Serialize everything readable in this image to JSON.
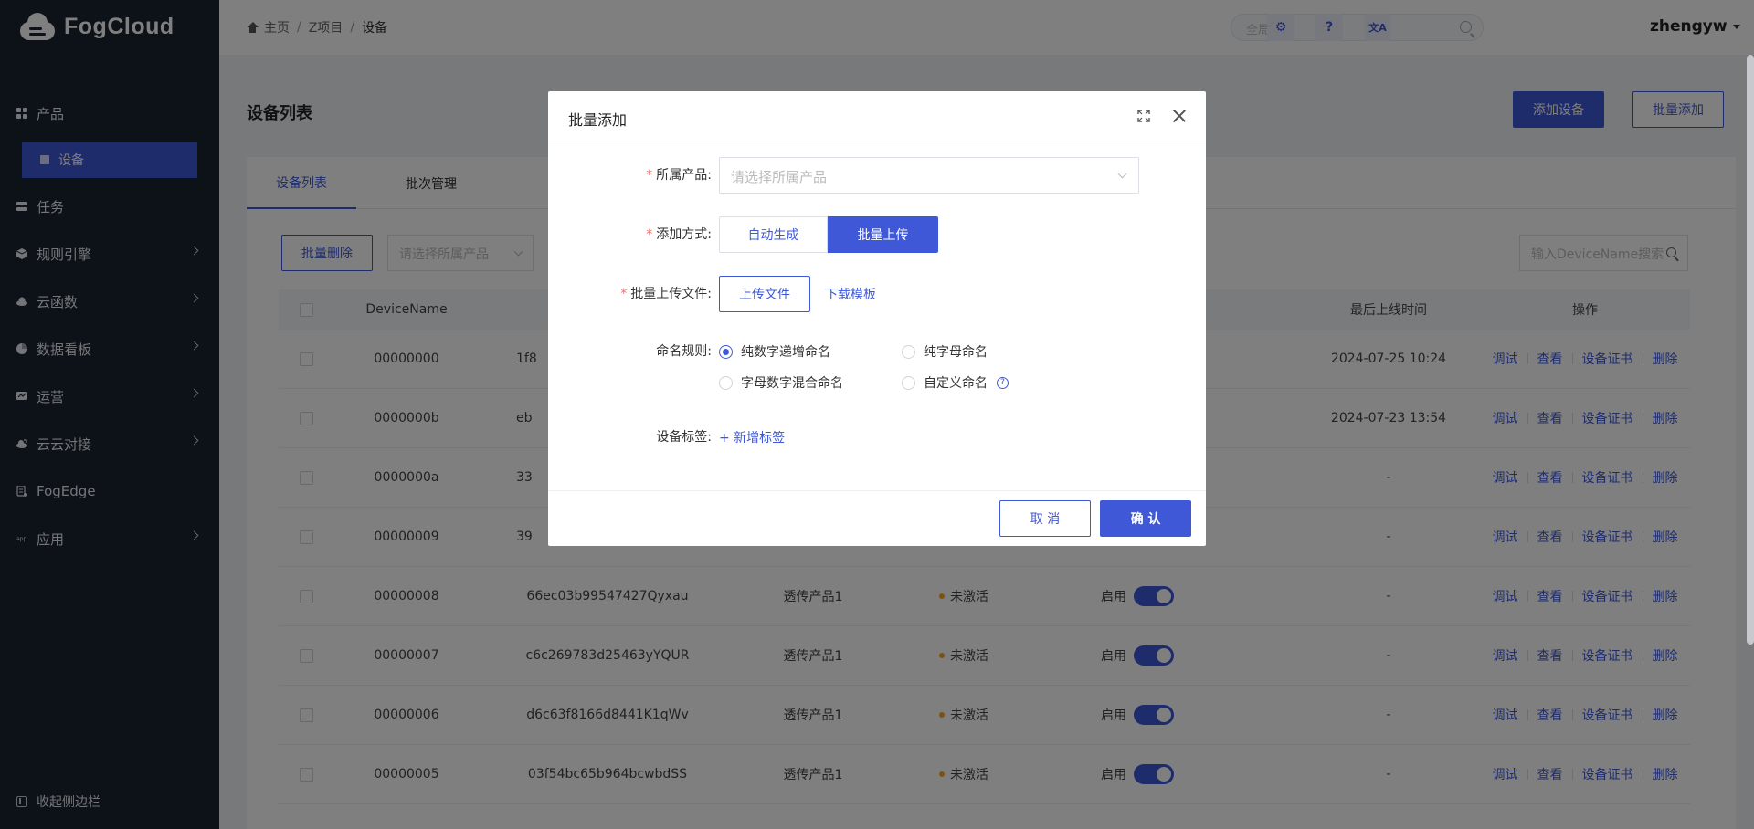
{
  "app": {
    "logo_text": "FogCloud"
  },
  "sidebar": {
    "items": [
      {
        "label": "产品",
        "icon": "grid-icon",
        "has_arrow": false
      },
      {
        "label": "设备",
        "icon": "device-icon",
        "active": true
      },
      {
        "label": "任务",
        "icon": "task-icon",
        "has_arrow": false
      },
      {
        "label": "规则引擎",
        "icon": "cube-icon",
        "has_arrow": true
      },
      {
        "label": "云函数",
        "icon": "cloud-icon",
        "has_arrow": true
      },
      {
        "label": "数据看板",
        "icon": "pie-icon",
        "has_arrow": true
      },
      {
        "label": "运营",
        "icon": "board-icon",
        "has_arrow": true
      },
      {
        "label": "云云对接",
        "icon": "cloud-link-icon",
        "has_arrow": true
      },
      {
        "label": "FogEdge",
        "icon": "edge-icon",
        "has_arrow": false
      },
      {
        "label": "应用",
        "icon": "app-icon",
        "has_arrow": true
      }
    ],
    "collapse_label": "收起侧边栏"
  },
  "header": {
    "breadcrumb": [
      "主页",
      "Z项目",
      "设备"
    ],
    "search_placeholder": "全局搜索",
    "settings_icon": "⚙",
    "help_icon": "?",
    "translate_icon": "文A",
    "username": "zhengyw"
  },
  "main": {
    "title": "设备列表",
    "add_device": "添加设备",
    "batch_add": "批量添加",
    "tabs": [
      "设备列表",
      "批次管理"
    ],
    "batch_delete": "批量删除",
    "product_filter_placeholder": "请选择所属产品",
    "search_placeholder": "输入DeviceName搜索",
    "columns": {
      "device_name": "DeviceName",
      "last_online": "最后上线时间",
      "ops": "操作"
    },
    "rows": [
      {
        "name": "00000000",
        "secret": "1f8",
        "product": "",
        "status": "",
        "enabled": "",
        "last_online": "2024-07-25 10:24"
      },
      {
        "name": "0000000b",
        "secret": "eb",
        "product": "",
        "status": "",
        "enabled": "",
        "last_online": "2024-07-23 13:54"
      },
      {
        "name": "0000000a",
        "secret": "33",
        "product": "",
        "status": "",
        "enabled": "",
        "last_online": "-"
      },
      {
        "name": "00000009",
        "secret": "39",
        "product": "",
        "status": "",
        "enabled": "",
        "last_online": "-"
      },
      {
        "name": "00000008",
        "secret": "66ec03b99547427Qyxau",
        "product": "透传产品1",
        "status": "未激活",
        "enabled": "启用",
        "last_online": "-"
      },
      {
        "name": "00000007",
        "secret": "c6c269783d25463yYQUR",
        "product": "透传产品1",
        "status": "未激活",
        "enabled": "启用",
        "last_online": "-"
      },
      {
        "name": "00000006",
        "secret": "d6c63f8166d8441K1qWv",
        "product": "透传产品1",
        "status": "未激活",
        "enabled": "启用",
        "last_online": "-"
      },
      {
        "name": "00000005",
        "secret": "03f54bc65b964bcwbdSS",
        "product": "透传产品1",
        "status": "未激活",
        "enabled": "启用",
        "last_online": "-"
      }
    ],
    "ops": [
      "调试",
      "查看",
      "设备证书",
      "删除"
    ]
  },
  "modal": {
    "title": "批量添加",
    "product_label": "所属产品:",
    "product_placeholder": "请选择所属产品",
    "method_label": "添加方式:",
    "method_options": [
      "自动生成",
      "批量上传"
    ],
    "method_selected": "批量上传",
    "upload_label": "批量上传文件:",
    "upload_button": "上传文件",
    "download_template": "下载模板",
    "naming_label": "命名规则:",
    "naming_options": [
      "纯数字递增命名",
      "纯字母命名",
      "字母数字混合命名",
      "自定义命名"
    ],
    "naming_selected": "纯数字递增命名",
    "tag_label": "设备标签:",
    "add_tag": "+ 新增标签",
    "cancel": "取 消",
    "confirm": "确 认"
  },
  "colors": {
    "primary": "#3f58d8",
    "sidebar_bg": "#1b2230",
    "required": "#f56c6c",
    "status_dot": "#f5a623"
  }
}
